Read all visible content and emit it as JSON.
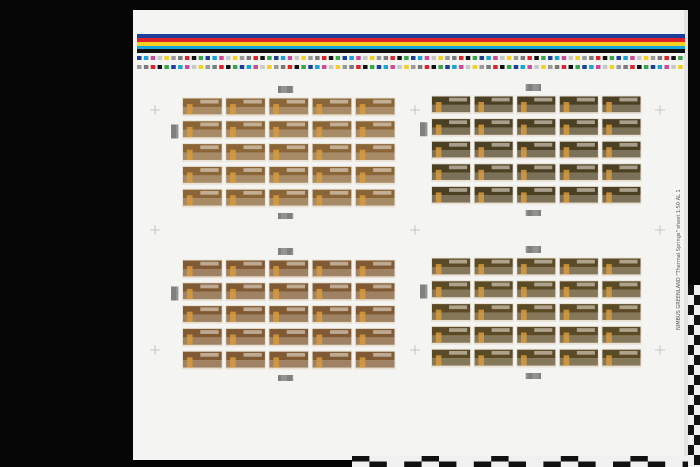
{
  "sheet": {
    "edge_label": "NIMBUS GREENLAND \"Thermal Springs\" sheet 1:50 AL 1"
  },
  "colors": {
    "background": "#050505",
    "paper": "#f4f4f2",
    "bar_colors": [
      "#1d3f9a",
      "#e0232b",
      "#f4d020",
      "#17a4dc",
      "#111111"
    ],
    "stamp_top_left": "#8a6538",
    "stamp_top_right": "#4c4024",
    "stamp_bottom_left": "#7f5a34",
    "stamp_bottom_right": "#5a4a26",
    "stamp_accent": "#d89a3c"
  },
  "panes": [
    {
      "id": "top-left",
      "rows": 5,
      "cols": 5
    },
    {
      "id": "top-right",
      "rows": 5,
      "cols": 5
    },
    {
      "id": "bottom-left",
      "rows": 5,
      "cols": 5
    },
    {
      "id": "bottom-right",
      "rows": 5,
      "cols": 5
    }
  ],
  "scale_bar_segments": 10
}
